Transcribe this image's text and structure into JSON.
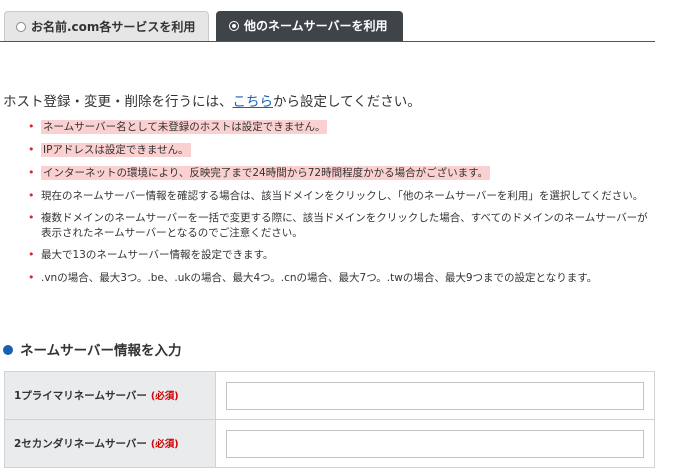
{
  "tabs": [
    {
      "label": "お名前.com各サービスを利用",
      "active": false
    },
    {
      "label": "他のネームサーバーを利用",
      "active": true
    }
  ],
  "intro": {
    "before": "ホスト登録・変更・削除を行うには、",
    "link": "こちら",
    "after": "から設定してください。"
  },
  "notes": [
    {
      "text": "ネームサーバー名として未登録のホストは設定できません。",
      "highlight": true
    },
    {
      "text": "IPアドレスは設定できません。",
      "highlight": true
    },
    {
      "text": "インターネットの環境により、反映完了まで24時間から72時間程度かかる場合がございます。",
      "highlight": true
    },
    {
      "text": "現在のネームサーバー情報を確認する場合は、該当ドメインをクリックし、「他のネームサーバーを利用」を選択してください。",
      "highlight": false
    },
    {
      "text": "複数ドメインのネームサーバーを一括で変更する際に、該当ドメインをクリックした場合、すべてのドメインのネームサーバーが表示されたネームサーバーとなるのでご注意ください。",
      "highlight": false
    },
    {
      "text": "最大で13のネームサーバー情報を設定できます。",
      "highlight": false
    },
    {
      "text": ".vnの場合、最大3つ。.be、.ukの場合、最大4つ。.cnの場合、最大7つ。.twの場合、最大9つまでの設定となります。",
      "highlight": false
    }
  ],
  "section": {
    "title": "ネームサーバー情報を入力"
  },
  "form": {
    "required_label": "(必須)",
    "rows": [
      {
        "label": "1プライマリネームサーバー",
        "value": ""
      },
      {
        "label": "2セカンダリネームサーバー",
        "value": ""
      }
    ]
  },
  "colors": {
    "accent": "#1a5fb4",
    "active_tab": "#3f4449",
    "highlight": "#fbd0d0",
    "bullet": "#d9232e",
    "required": "#cc0000"
  }
}
